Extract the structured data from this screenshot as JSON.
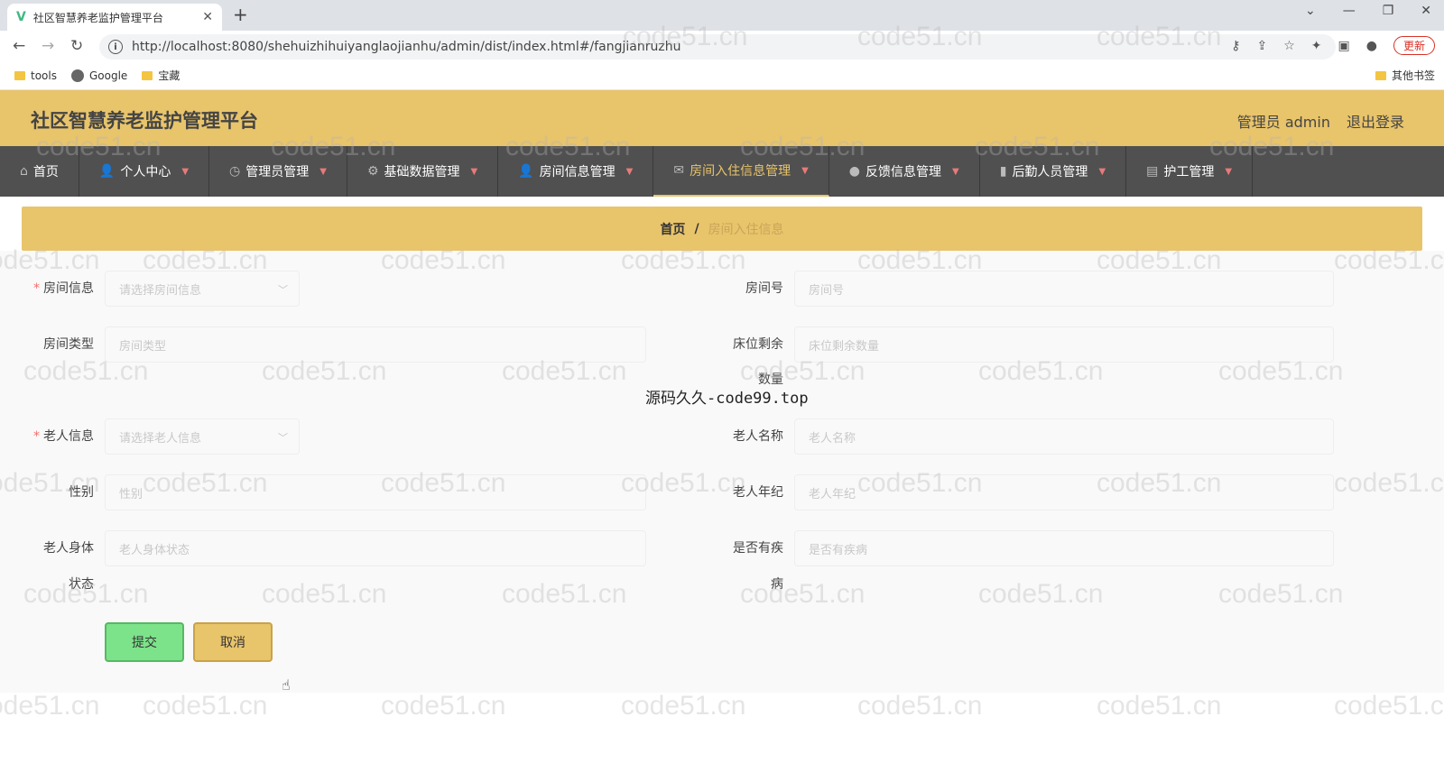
{
  "browser": {
    "tab_title": "社区智慧养老监护管理平台",
    "url": "http://localhost:8080/shehuizhihuiyanglaojianhu/admin/dist/index.html#/fangjianruzhu",
    "update_label": "更新",
    "bookmarks": [
      "tools",
      "Google",
      "宝藏"
    ],
    "other_bookmarks": "其他书签"
  },
  "header": {
    "title": "社区智慧养老监护管理平台",
    "user": "管理员 admin",
    "logout": "退出登录"
  },
  "menu": [
    {
      "label": "首页",
      "icon": "home-icon"
    },
    {
      "label": "个人中心",
      "icon": "user-icon"
    },
    {
      "label": "管理员管理",
      "icon": "clock-icon"
    },
    {
      "label": "基础数据管理",
      "icon": "gear-icon"
    },
    {
      "label": "房间信息管理",
      "icon": "user-icon"
    },
    {
      "label": "房间入住信息管理",
      "icon": "mail-icon"
    },
    {
      "label": "反馈信息管理",
      "icon": "pin-icon"
    },
    {
      "label": "后勤人员管理",
      "icon": "chart-icon"
    },
    {
      "label": "护工管理",
      "icon": "clipboard-icon"
    }
  ],
  "breadcrumb": {
    "home": "首页",
    "separator": "/",
    "current": "房间入住信息"
  },
  "form": {
    "room_info_label": "房间信息",
    "room_info_placeholder": "请选择房间信息",
    "room_no_label": "房间号",
    "room_no_placeholder": "房间号",
    "room_type_label": "房间类型",
    "room_type_placeholder": "房间类型",
    "beds_left_label": "床位剩余",
    "beds_left_label2": "数量",
    "beds_left_placeholder": "床位剩余数量",
    "elder_info_label": "老人信息",
    "elder_info_placeholder": "请选择老人信息",
    "elder_name_label": "老人名称",
    "elder_name_placeholder": "老人名称",
    "gender_label": "性别",
    "gender_placeholder": "性别",
    "elder_age_label": "老人年纪",
    "elder_age_placeholder": "老人年纪",
    "health_label": "老人身体",
    "health_label2": "状态",
    "health_placeholder": "老人身体状态",
    "disease_label": "是否有疾",
    "disease_label2": "病",
    "disease_placeholder": "是否有疾病",
    "submit": "提交",
    "cancel": "取消"
  },
  "overlay_text": "源码久久-code99.top",
  "watermark": "code51.cn"
}
